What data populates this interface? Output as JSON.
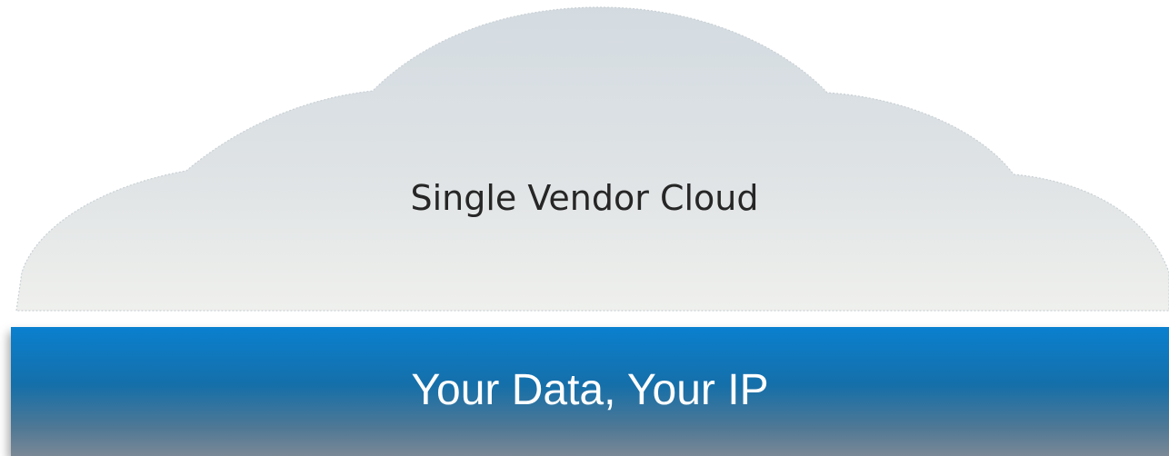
{
  "cloud": {
    "label": "Single Vendor Cloud"
  },
  "data_bar": {
    "label": "Your Data, Your IP"
  },
  "colors": {
    "cloud_top": "#d3dbe1",
    "cloud_bottom": "#eff0ed",
    "bar_top": "#0a80cf",
    "bar_bottom": "#7a8896",
    "bar_text": "#ffffff",
    "cloud_text": "#262626"
  }
}
